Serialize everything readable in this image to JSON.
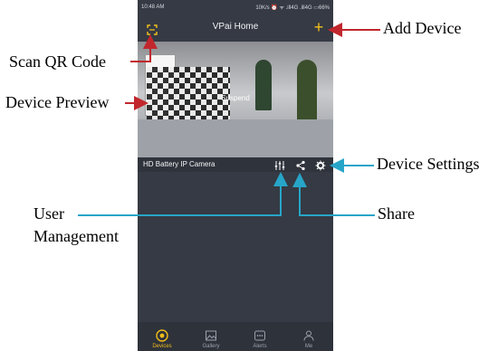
{
  "status": {
    "time": "10:48 AM",
    "right": "10K/s ⏰ ᯤ .ill4G .ill4G ▭66%"
  },
  "app": {
    "title": "VPai Home"
  },
  "preview": {
    "overlay_text": "Suspend"
  },
  "device": {
    "name": "HD Battery IP Camera"
  },
  "nav": [
    {
      "label": "Devices",
      "icon": "devices-icon"
    },
    {
      "label": "Gallery",
      "icon": "gallery-icon"
    },
    {
      "label": "Alerts",
      "icon": "alerts-icon"
    },
    {
      "label": "Me",
      "icon": "me-icon"
    }
  ],
  "annotations": {
    "scan": "Scan QR Code",
    "add": "Add Device",
    "preview": "Device Preview",
    "settings": "Device Settings",
    "user1": "User",
    "user2": "Management",
    "share": "Share"
  },
  "colors": {
    "accent": "#f4c21b",
    "arrow_red": "#c1272d",
    "arrow_blue": "#27a5c8"
  }
}
